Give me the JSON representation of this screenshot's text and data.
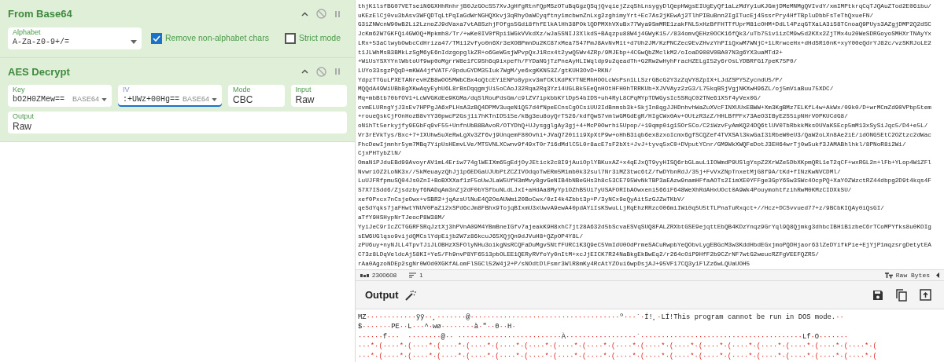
{
  "recipe": [
    {
      "title": "From Base64",
      "rows": [
        [
          {
            "kind": "select",
            "label": "Alphabet",
            "value": "A-Za-z0-9+/="
          },
          {
            "kind": "checkbox",
            "label": "Remove non-alphabet chars",
            "checked": true
          },
          {
            "kind": "checkbox",
            "label": "Strict mode",
            "checked": false
          }
        ]
      ]
    },
    {
      "title": "AES Decrypt",
      "rows": [
        [
          {
            "kind": "toggle",
            "label": "Key",
            "value": "bO2H0ZMew==",
            "option": "BASE64",
            "focused": false
          },
          {
            "kind": "toggle",
            "label": "IV",
            "value": ":+UWz+00Hg==",
            "option": "BASE64",
            "focused": true
          },
          {
            "kind": "plain",
            "label": "Mode",
            "value": "CBC"
          },
          {
            "kind": "plain",
            "label": "Input",
            "value": "Raw"
          }
        ],
        [
          {
            "kind": "plain",
            "label": "Output",
            "value": "Raw"
          }
        ]
      ]
    }
  ],
  "input": {
    "lines": [
      "thjK1lsfBG07VETseiN6GXHhRnhrjB0JzGOcS57XvJgHfgRtnfQpMSzOTuBqGgzQSqjQvqiejZzqShLnsygyDlQepHWgsEIUgEyQf1aLzMdYy1uKJGmjDMeMNMgQVIvdY/xmIMPtkrqCqTJQAuZTod2E06ibu/",
      "uKEzElCj0vu3bAsv3WFQDTqLtPqIaGdWrNGHQXkvj3qRhyOaWCyqftny1mcbwnZnLxg2zghimyYrt+Ec7As2jKEwAj2TlhPIBuBnn2IgITucEj4SssrPry4HfTBpluDbbFsTeThQxueFN/",
      "G31ZNWcnW90wB2Li2LznoZJ9dVaxa7vtA8SzhjFOfgs5Gdi8fhfElkAlHh38POklQDPMXhVXuBx77Wya9SmMRE1zakFNL5xHzBfFHTTfUprM81cOHM+DdLl4PzqGTXaLA3iS8TCnoaQ9PUys3AZgjDMP2Q2dSC",
      "JcKm62W7GKFQi4GWOQ+Mpkmh8/Tr/+wKe0IV0fRpi1WGkVVkdXz/wJa5SNIJ3XlkdS+BAqzpu88W4j4GWyK15//834omvQEHz0OCK16fQk3/uTb751v1izCM9w5d2KXx2ZjTMx4u20WeSDRGoyoSMHXrTNAyYx",
      "LRx+53aClwybOwbcCdHriza47/TMi12vfyo0n6Xr3eXOBPmnDu2KC87xMea7S47PmJ8AvNvM1t+d7Uh2JM/KzPNCZec9EvZHvzYhPIiQxwM7WNjC+1LRrwceHx+dHdSR10nK+xyY00eQdrYJ82c/vzSKRJoLE2",
      "t1JLWhMsB3BMkLzSgM6yE6nIdzgopglkZR+o6GeWGsjWPvpQxJ1Rcx4t2ywQ5Wv4ZRp/9MJEbp+4CGwQbZMclkM2/oIoaD908V0BA07N3g6YX3uaMTd2+",
      "+WiUsYSXYYnlWbtoUf9wp0oMgrrW8e1fC9Sh6q9ixpefh/FYDaNGjTzPneAyHLIWqldp9u2qeadTh+G2Rw2wHyhFracHZELgI52y6rOsLYDBRfG17peK75P0/",
      "LUYo33sgzPQqD+mKWA4jfVATF/0pduGYDM35Iuk7WgM/ye6xgKKN53Z/gtKUH3OvD+RKN/",
      "YdpzTTGuLPXETANrevHZB8wOO5MWbCBx4oQtcEYiENPo8ypxv3mfCKlKdPKYTNEMhHOOLcWsPsn1LLSzrGBcG2Y3zZqVY8ZpIX+LJdZSPY5ZycndU5/P/",
      "MQQdA49WiUBb8gXKwAqyEyhU6L8rBsDqqgmjUi5oCAoJ32Rqa2Rq3Yz14UGLBk5EeQnHOtHFH0hTRRKUb+XJVVAyz2zG3/L75kqBSjVgjNKXwH96ZL/oj5mViaBuu75XDC/",
      "Mq+mbBtb70bfOV1+LcWVGKdEe9KGMa/dqSlRouPdsGm/c9lZV7ipkbbKYlDp54bIDS+uh4RyL8CPqMYpTDWGysIc5SRqC02TNe61X5f4yVex0G/",
      "cvmELURngYjJ3sEv7HPPgJA6xPLHsA3zBQ4DPMV3uqeN1Q57d4fNpeECnsCgOCsiUU2IdBnmsb3k+SkjIn8qgJJHDnhvhWaZuXVcFINXUUxEBWW+Xm3KgBMz7ELKfL4w+AkWx/09k0/D+wrMCmZd90VPbp5tem",
      "+roueQskCjFOnHozB8vYY30pwcP2Gsj1i7hKTnID515e/kBg3eu8oyQrT526/kdfQwS7vmlwGMGdEgR/HIgCWx0Av+OUtzR3zZ/HHLBfPFx73AeO3IByE2S5ipNHrVOPKUCdG8/",
      "oN1hTt5erkyjfy9EGbFq9vF55+UnfnUbB8BAvoR/OTYDhQ+UJysgglgAy3gj+4+McP0Owrhi5Upop/+19qmp0ig1SOrSCo/C2iWzvFyAmKQ24DQ6tlUV0TbRbkkMksOUVaKSEcp5mM13xSySiJqc5/D4+e5L/",
      "Vr3rEVkTys/Bxc+7+IXUhw5uXeRwLgXv3Zf6vj9UnqemF80Ovhi+JVaQ72011i9XpXtP9w+oHhB3iqb6ex8zxoIcmx6gfSCQZef4TVXSAl3kwGaI31RbeW0eU3/QaW2oLXn8Ae2iE/idONG5EtC2OZtzc2dWac",
      "FhcDewIjmnhr5ym7MBq7YipUsHEmvLVe/MT5VNLXCwnv9f49xT0r716dMdlC5L0r8acE7sF2bXt+JvJ+tyvq5xC0+DVputYCnr/GM9WkXWQFeDotJ3EH64wrTj0w5ukf3JAMABhlhkl/8PNoR8i2Wi/",
      "CjxPHTybZlN/",
      "OmaN1PJduEBd99AvoyrAV1mL4Eriw774glWEIXm65gEdjOyJEtick2c8I9jAuiOplYBKuxAZ+x4qEJxQT9yyHISQ6rbGLauL1IOWmdP9USlgYspZ2XrWZe5DbXKpmQRL1eT2qCF+wxRGL2n+lFb+YLop4W1ZFl",
      "NvwriOZ2LoNK3x//5kMeuayzQhJj1p6EDGaUJUbPtZCZIVOdqoTwERm5M1mb0k32sul7Nr3iMZ3twc6tZ/fwDYbnRdJ/35j+FvVxZNpTnxetMjG8f9A/tKd+fINzKwNVCDMl/",
      "LuUJFRfpmuSQ04Js0ZnI+BoBXXXaf1zF5oUwJLaW5UfH3mMvy8gvGeNIB4bNBeGHs3h8c53CE795WvNkTBP3aEAzw9namHFfaAOTs2IimXE0YFFge3GpY6Sw3SWc4OcpPQ+XaYOZWzctRZ44dbpg2D9t4kqs4F",
      "S7X7ISdd6/Zjsdzbyf6NADqAm3nZj2dF0bYSfbuNLdLJxI+aHdAa8MyYp1OZhB5Ui7yUSAFORIbAOwxeni566iF648WeXhRdAHxUOct0A9Wk4PouymohtfzihRwM0KMzCIDXkSU/",
      "xef0Pxcx7nCsjeOwx+vSBR2+jqAzsUlNuE4Q2OeAUWmi20BoCwx/0zI4k4Zbbt3p+P/3yNCx9eQyAit5zGJZwTKbV/",
      "qeSdYqks7jaFHwtYNUV0PaZi2xSPd6cJm8FBhx9TojqBIxmU3xUwvA9ewA40pdAYiIsKSwuLLjRqEhzRRzcO06miIWi0q5U5tTLPnaTuRxqct+//Hcz+DCSvvued77+z/9BCbKIQAy0iQsGI/",
      "aTfY9HSHypNrTJeocP8W38M/",
      "YyiJeC9rIcZCTGGRFSRqJztXj3hPVnA09M4YBmBneIGfv7ajeakK9H8xhC7jt28A632d5bScvaESVqSUQ8FALZRXbtGSE9ejqttEbQB4KDzYnqz9GrYql9Q8Qjmkg3dhbcIBH1B1zbeC6rTCoMPYfks8u0KOIg",
      "sEW6UGlqso9vijdQMCslYdpEijb2W7z86kcuJ65XQjQn9dJVuH8+QZpOP4Y8L/",
      "zPU6uy+nyNJLL4TpvTJiJLOBHzXSFOlyNHu3oikgNsRCQFaDuMgv5NtfFURC1K3Q9eC5VmIdU0OdPrmeSACuRwpbYeQObvLygEBGcM3w3KddHbdEGxjmoPQDHjaor63lZeDYifkPie+EjYjP1mqzsrgDetytEA",
      "C73z8LDqVeldcAj58KI+Ye5/Fh9nvP8YF6513pbOLEE1QERyRVfoYy0nItM+xcJjEICK7R24NaBkgEkBwEq2/r264cOiP9HfF2b9CZrNF7wtG2weucRZFgVEEFQZR5/",
      "rAa0AgzoNDEp2sgNr0WOd0XGKfALomFlSGCl52W4j2+P/sNOdtDlFsmr3WlR8mKy4RcAtYZOui6wpDsjAJ+95VF17CQ3y1FlZz6wLQUaUOH5"
    ]
  },
  "status_bar": {
    "length": "2300608",
    "lines": "1",
    "format": "Raw Bytes"
  },
  "output": {
    "title": "Output",
    "lines": [
      [
        {
          "kind": "text",
          "text": "MZ"
        },
        {
          "kind": "ctrl",
          "text": "············"
        },
        {
          "kind": "text",
          "text": "ÿÿ"
        },
        {
          "kind": "ctrl",
          "text": "··"
        },
        {
          "kind": "text",
          "text": "¸"
        },
        {
          "kind": "ctrl",
          "text": "·······"
        },
        {
          "kind": "text",
          "text": "@"
        },
        {
          "kind": "ctrl",
          "text": "····································"
        },
        {
          "kind": "text",
          "text": "º"
        },
        {
          "kind": "ctrl",
          "text": "···"
        },
        {
          "kind": "text",
          "text": "´"
        },
        {
          "kind": "ctrl",
          "text": "·"
        },
        {
          "kind": "text",
          "text": "Í!¸"
        },
        {
          "kind": "ctrl",
          "text": "·"
        },
        {
          "kind": "text",
          "text": "LÍ!This program cannot be run in DOS mode."
        },
        {
          "kind": "ctrl",
          "text": "··"
        }
      ],
      [
        {
          "kind": "text",
          "text": "$"
        },
        {
          "kind": "ctrl",
          "text": "·······"
        },
        {
          "kind": "text",
          "text": "PE"
        },
        {
          "kind": "ctrl",
          "text": "··"
        },
        {
          "kind": "text",
          "text": "L"
        },
        {
          "kind": "ctrl",
          "text": "···"
        },
        {
          "kind": "text",
          "text": "^"
        },
        {
          "kind": "ctrl",
          "text": "·"
        },
        {
          "kind": "text",
          "text": "wø"
        },
        {
          "kind": "ctrl",
          "text": "········"
        },
        {
          "kind": "text",
          "text": "à"
        },
        {
          "kind": "ctrl",
          "text": "·"
        },
        {
          "kind": "text",
          "text": "\""
        },
        {
          "kind": "ctrl",
          "text": "··"
        },
        {
          "kind": "text",
          "text": "0"
        },
        {
          "kind": "ctrl",
          "text": "··"
        },
        {
          "kind": "text",
          "text": "H"
        },
        {
          "kind": "ctrl",
          "text": "·"
        }
      ],
      [
        {
          "kind": "ctrl",
          "text": "······"
        },
        {
          "kind": "text",
          "text": "f"
        },
        {
          "kind": "ctrl",
          "text": "···  ···"
        },
        {
          "kind": "ctrl",
          "text": "·····"
        },
        {
          "kind": "text",
          "text": "@"
        },
        {
          "kind": "ctrl",
          "text": "·· ·························"
        },
        {
          "kind": "text",
          "text": "À"
        },
        {
          "kind": "ctrl",
          "text": "·················"
        },
        {
          "kind": "text",
          "text": "`"
        },
        {
          "kind": "ctrl",
          "text": "·······································"
        },
        {
          "kind": "text",
          "text": "Lf"
        },
        {
          "kind": "ctrl",
          "text": "·"
        },
        {
          "kind": "text",
          "text": "O"
        },
        {
          "kind": "ctrl",
          "text": "·······"
        }
      ],
      [
        {
          "kind": "ctrl",
          "text": "···*·(····*·(····*·(····*·(····*·(····*·(····*·(····*·(····*·(····*·(····*·(····*·(····*·(····*·(····*·(····*·(····*·(····*·("
        }
      ],
      [
        {
          "kind": "ctrl",
          "text": "···*·(····*·(····*·(····*·(····*·(····*·(····*·(····*·(····*·(····*·(····*·(····*·(····*·(····*·(····*·(····*·(····*·(····*·("
        }
      ]
    ]
  }
}
